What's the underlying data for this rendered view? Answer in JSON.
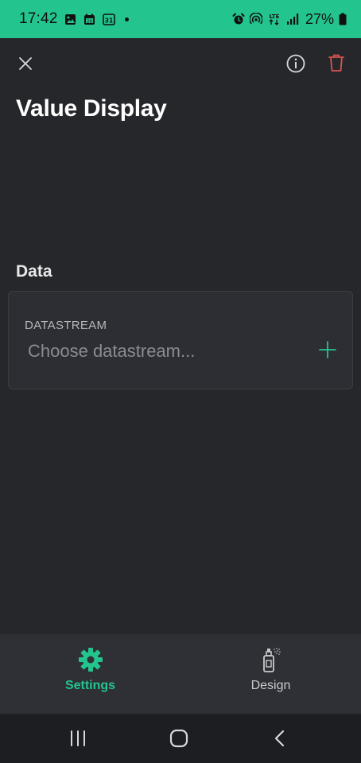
{
  "status_bar": {
    "time": "17:42",
    "battery": "27%",
    "network": "LTE",
    "background_color": "#23c48e"
  },
  "header": {
    "title": "Value Display",
    "close_icon": "close-icon",
    "info_icon": "info-icon",
    "delete_icon": "trash-icon",
    "delete_color": "#d9534f"
  },
  "data_section": {
    "title": "Data",
    "datastream": {
      "label": "DATASTREAM",
      "placeholder": "Choose datastream...",
      "add_icon": "plus-icon"
    }
  },
  "tabs": [
    {
      "label": "Settings",
      "icon": "gear-icon",
      "active": true
    },
    {
      "label": "Design",
      "icon": "spray-paint-icon",
      "active": false
    }
  ],
  "colors": {
    "accent": "#23c48e",
    "background": "#26272b",
    "card": "#2d2e33",
    "tab_bar": "#2f3036"
  },
  "nav_bar": {
    "recents_icon": "recents-icon",
    "home_icon": "home-icon",
    "back_icon": "back-icon"
  }
}
